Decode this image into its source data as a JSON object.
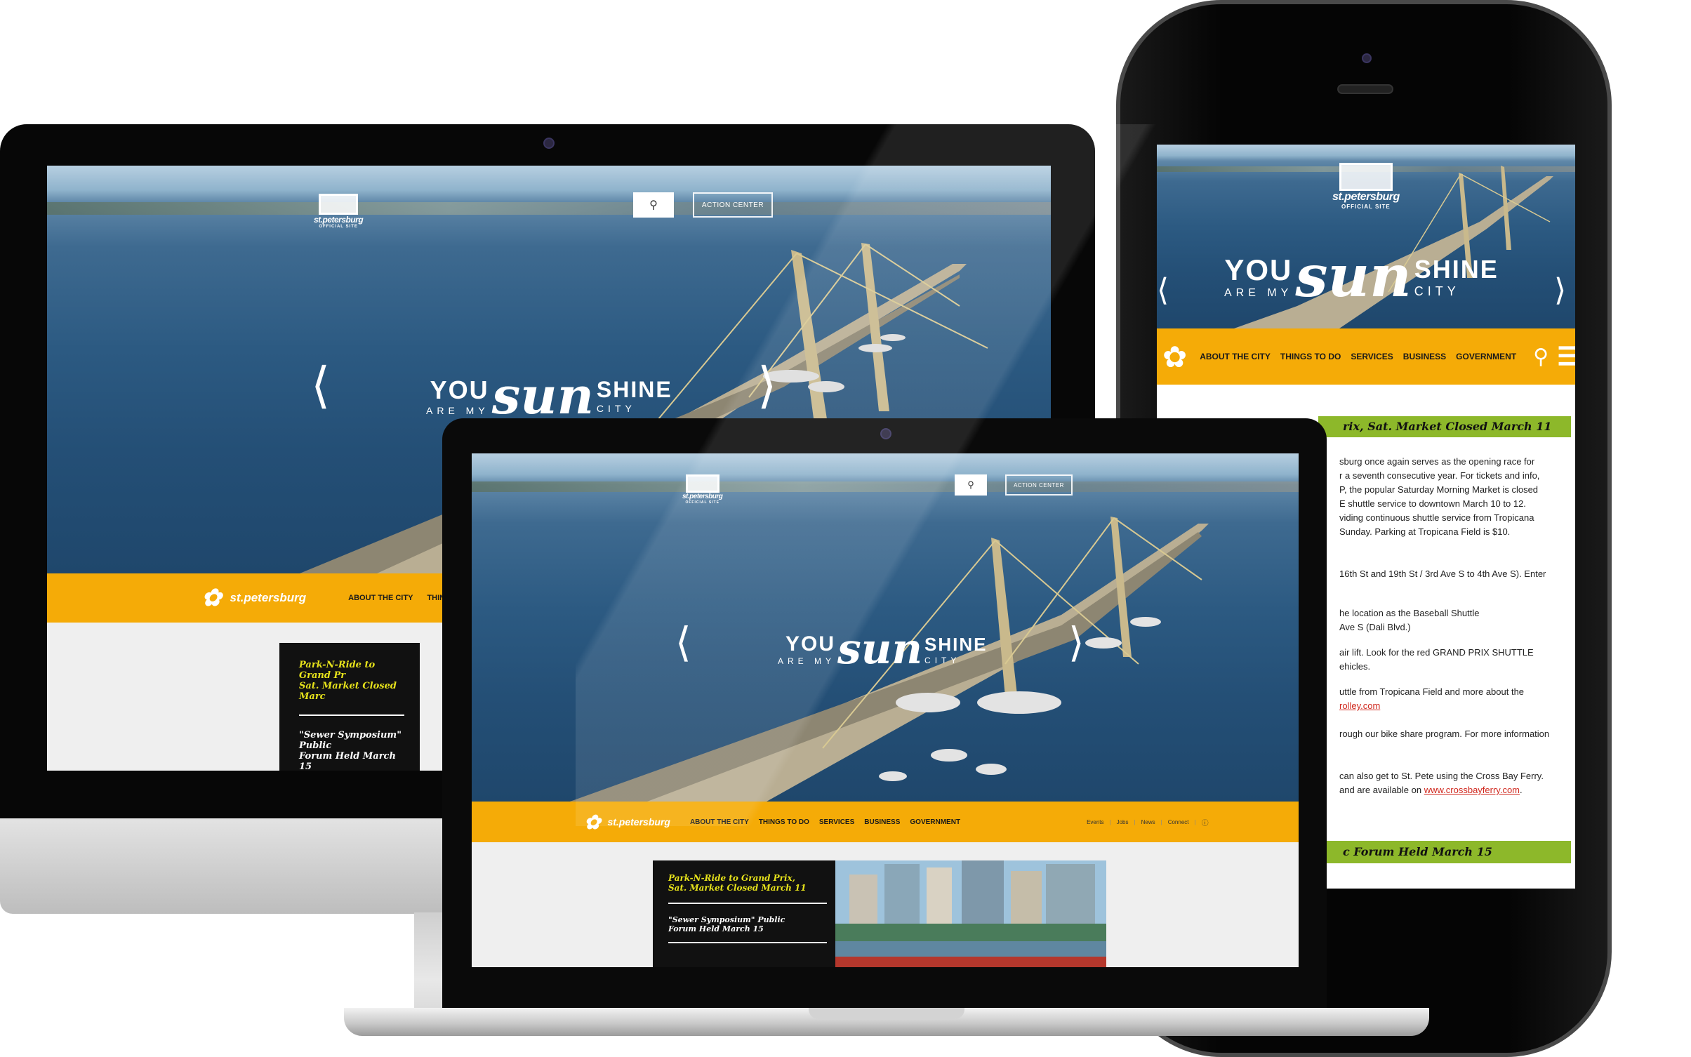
{
  "site": {
    "logo_name": "st.petersburg",
    "logo_sub": "OFFICIAL SITE",
    "action_center": "ACTION CENTER",
    "tagline": {
      "you": "YOU",
      "are_my": "ARE MY",
      "sun": "sun",
      "shine": "SHINE",
      "city": "CITY"
    },
    "nav": [
      "ABOUT THE CITY",
      "THINGS TO DO",
      "SERVICES",
      "BUSINESS",
      "GOVERNMENT"
    ],
    "utility": [
      "Events",
      "Jobs",
      "News",
      "Connect"
    ],
    "news": [
      "Park-N-Ride to Grand Prix, Sat. Market Closed March 11",
      "\"Sewer Symposium\" Public Forum Held March 15"
    ]
  },
  "desktop": {
    "nav_visible": [
      "ABOUT THE CITY",
      "THINGS TO D"
    ],
    "news": [
      "Park-N-Ride to Grand Pr",
      "Sat. Market Closed Marc",
      "\"Sewer Symposium\" Public",
      "Forum Held March 15"
    ]
  },
  "laptop": {
    "news": [
      "Park-N-Ride to Grand Prix,",
      "Sat. Market Closed March 11",
      "\"Sewer Symposium\" Public",
      "Forum Held March 15"
    ]
  },
  "phone": {
    "nav": [
      "ABOUT THE CITY",
      "THINGS TO DO",
      "SERVICES",
      "BUSINESS",
      "GOVERNMENT"
    ],
    "article_title": "rix, Sat. Market Closed March 11",
    "article_lines": [
      "sburg once again serves as the opening race for",
      "r a seventh consecutive year. For tickets and info,",
      "P, the popular Saturday Morning Market is closed",
      "E shuttle service to downtown March 10 to 12.",
      "viding continuous shuttle service from Tropicana",
      "Sunday. Parking at Tropicana Field is $10.",
      "16th St and 19th St / 3rd Ave S to 4th Ave S). Enter",
      "he location as the Baseball Shuttle",
      "Ave S (Dali Blvd.)",
      "air lift. Look for the red GRAND PRIX SHUTTLE",
      "ehicles.",
      "uttle from Tropicana Field and more about the",
      "rolley.com",
      "rough our bike share program. For more information",
      "can also get to St. Pete using the Cross Bay Ferry.",
      "and are available on",
      "www.crossbayferry.com",
      "."
    ],
    "second_title": "c Forum Held March 15"
  },
  "colors": {
    "accent": "#f5ab07",
    "news_bg": "#111111",
    "headline_yellow": "#e6e21b",
    "phone_title_bar": "#8db82a",
    "link": "#d0281e"
  }
}
